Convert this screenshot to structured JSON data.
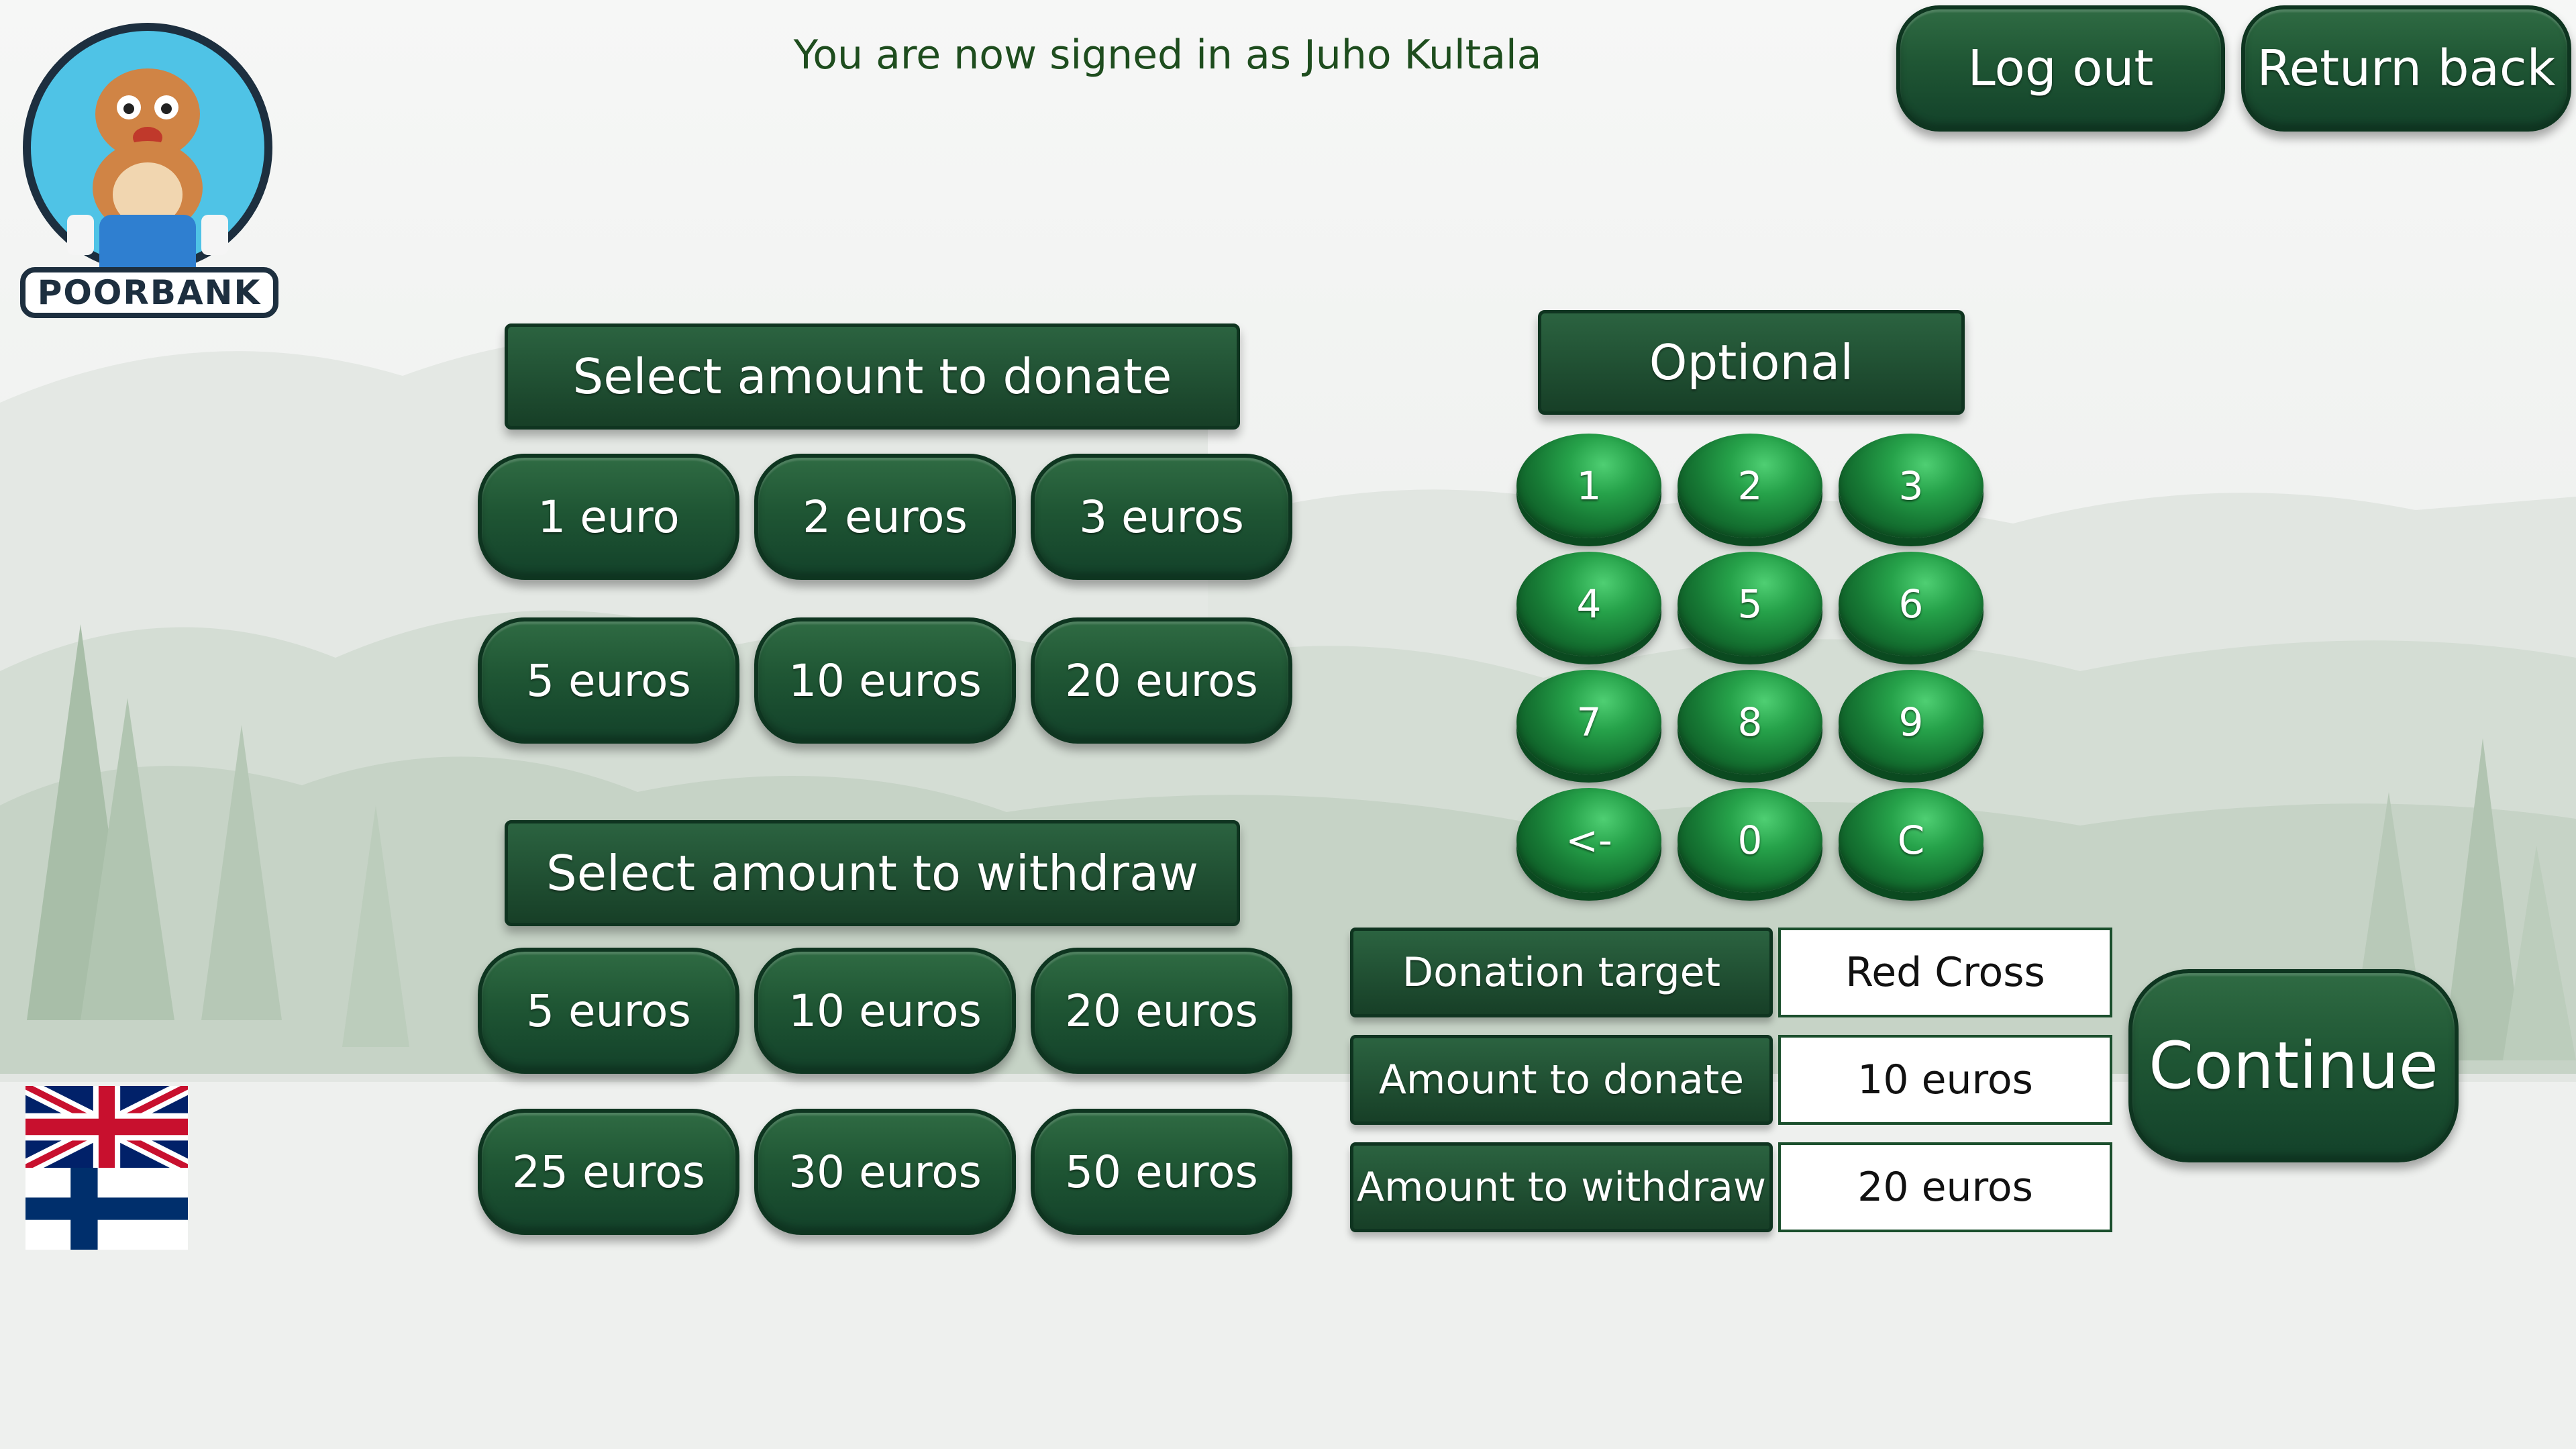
{
  "session": {
    "status_text": "You are now signed in as Juho Kultala"
  },
  "header": {
    "logout_label": "Log out",
    "return_label": "Return back"
  },
  "logo": {
    "text": "POORBANK"
  },
  "donate": {
    "title": "Select amount to donate",
    "options": [
      "1 euro",
      "2 euros",
      "3 euros",
      "5 euros",
      "10 euros",
      "20 euros"
    ]
  },
  "withdraw": {
    "title": "Select amount to withdraw",
    "options": [
      "5 euros",
      "10 euros",
      "20 euros",
      "25 euros",
      "30 euros",
      "50 euros"
    ]
  },
  "keypad": {
    "title": "Optional",
    "keys": [
      "1",
      "2",
      "3",
      "4",
      "5",
      "6",
      "7",
      "8",
      "9",
      "<-",
      "0",
      "C"
    ]
  },
  "summary": {
    "rows": [
      {
        "label": "Donation target",
        "value": "Red Cross"
      },
      {
        "label": "Amount to donate",
        "value": "10 euros"
      },
      {
        "label": "Amount to withdraw",
        "value": "20 euros"
      }
    ]
  },
  "continue_label": "Continue",
  "languages": [
    "English",
    "Finnish"
  ],
  "colors": {
    "button_green": "#1f5634",
    "key_green": "#26a24a",
    "status_text": "#1e4d1e"
  }
}
